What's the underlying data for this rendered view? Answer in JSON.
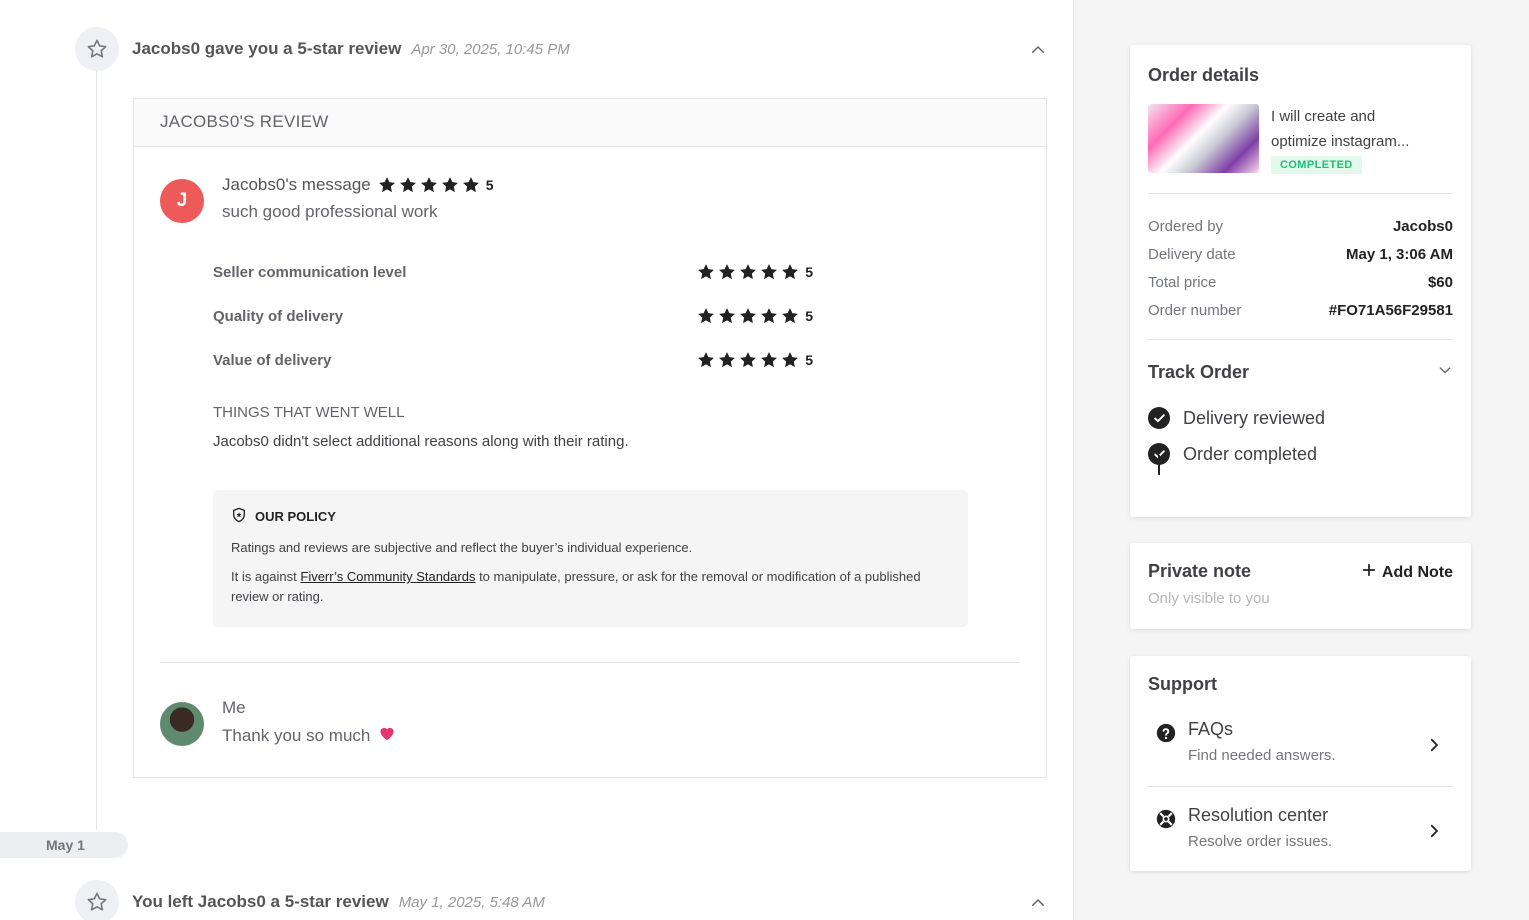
{
  "events": [
    {
      "title": "Jacobs0 gave you a 5-star review",
      "time": "Apr 30, 2025, 10:45 PM"
    },
    {
      "title": "You left Jacobs0 a 5-star review",
      "time": "May 1, 2025, 5:48 AM"
    }
  ],
  "review": {
    "header": "JACOBS0'S REVIEW",
    "avatar_letter": "J",
    "message_label": "Jacobs0's message",
    "overall_rating": "5",
    "message": "such good professional work",
    "ratings": [
      {
        "label": "Seller communication level",
        "value": "5"
      },
      {
        "label": "Quality of delivery",
        "value": "5"
      },
      {
        "label": "Value of delivery",
        "value": "5"
      }
    ],
    "went_well_title": "THINGS THAT WENT WELL",
    "went_well_text": "Jacobs0 didn't select additional reasons along with their rating.",
    "policy": {
      "title": "OUR POLICY",
      "line1": "Ratings and reviews are subjective and reflect the buyer’s individual experience.",
      "line2_pre": "It is against ",
      "line2_link": "Fiverr’s Community Standards",
      "line2_post": " to manipulate, pressure, or ask for the removal or modification of a published review or rating."
    },
    "reply": {
      "name": "Me",
      "text": "Thank you so much"
    }
  },
  "date_separator": "May 1",
  "order_details": {
    "title": "Order details",
    "gig_title": "I will create and optimize instagram...",
    "status": "COMPLETED",
    "rows": [
      {
        "key": "Ordered by",
        "value": "Jacobs0"
      },
      {
        "key": "Delivery date",
        "value": "May 1, 3:06 AM"
      },
      {
        "key": "Total price",
        "value": "$60"
      },
      {
        "key": "Order number",
        "value": "#FO71A56F29581"
      }
    ],
    "track_title": "Track Order",
    "steps": [
      "Delivery reviewed",
      "Order completed"
    ]
  },
  "private_note": {
    "title": "Private note",
    "subtitle": "Only visible to you",
    "add_label": "Add Note"
  },
  "support": {
    "title": "Support",
    "items": [
      {
        "title": "FAQs",
        "subtitle": "Find needed answers.",
        "icon": "question-icon"
      },
      {
        "title": "Resolution center",
        "subtitle": "Resolve order issues.",
        "icon": "lifebuoy-icon"
      }
    ]
  }
}
